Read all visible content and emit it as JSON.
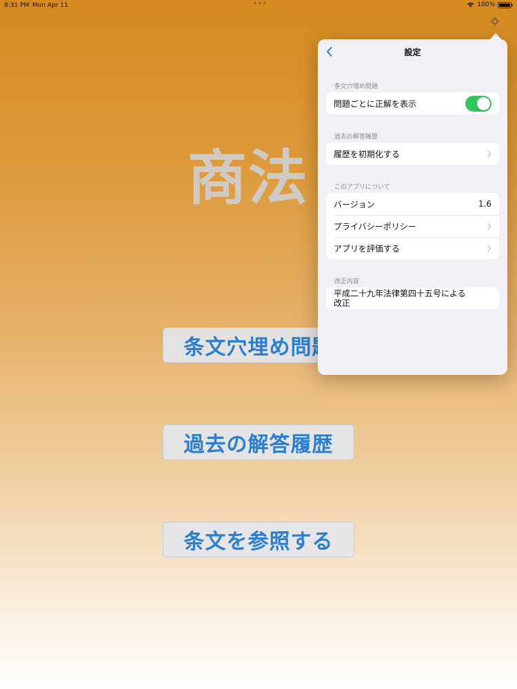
{
  "status_bar": {
    "time": "8:31 PM",
    "date": "Mon Apr 11",
    "dots": "•••",
    "battery": "100%"
  },
  "main": {
    "title": "商法",
    "buttons": [
      {
        "label": "条文穴埋め問題"
      },
      {
        "label": "過去の解答履歴"
      },
      {
        "label": "条文を参照する"
      }
    ],
    "settings_icon": "gear-icon"
  },
  "settings": {
    "title": "設定",
    "back_icon": "chevron-left-icon",
    "sections": [
      {
        "header": "条文穴埋め問題",
        "rows": [
          {
            "label": "問題ごとに正解を表示",
            "toggle_on": true
          }
        ]
      },
      {
        "header": "過去の解答履歴",
        "rows": [
          {
            "label": "履歴を初期化する"
          }
        ]
      },
      {
        "header": "このアプリについて",
        "rows": [
          {
            "label": "バージョン",
            "value": "1.6"
          },
          {
            "label": "プライバシーポリシー"
          },
          {
            "label": "アプリを評価する"
          }
        ]
      },
      {
        "header": "改正内容",
        "note": "平成二十九年法律第四十五号による改正"
      }
    ]
  },
  "colors": {
    "accent": "#2b7fd0",
    "toggle_on": "#34c759",
    "title_gray": "#cfcac3"
  }
}
